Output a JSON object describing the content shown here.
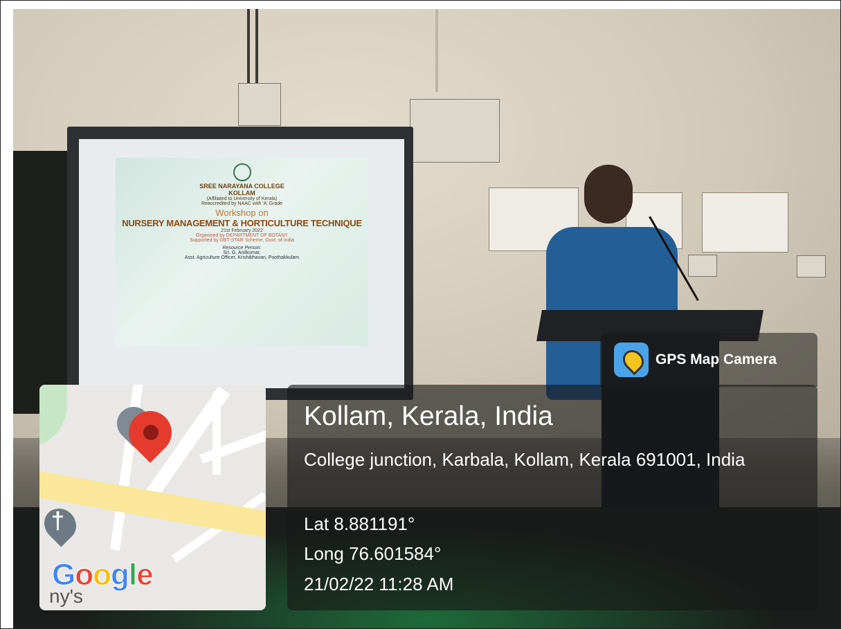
{
  "slide": {
    "line1": "SREE NARAYANA COLLEGE",
    "line1b": "KOLLAM",
    "line2": "(Affiliated to University of Kerala)",
    "line2b": "Reaccredited by NAAC with 'A' Grade",
    "line3": "Workshop on",
    "line4": "NURSERY MANAGEMENT & HORTICULTURE TECHNIQUE",
    "date": "21st February 2022",
    "organised": "Organised by DEPARTMENT OF BOTANY",
    "supported": "Supported by DBT-STAR Scheme, Govt. of India",
    "rp_label": "Resource Person:",
    "rp_name": "Sri. G. Anilkumar,",
    "rp_role": "Asst. Agriculture Officer, Krishibhavan, Poothakkulam"
  },
  "gps": {
    "app_name": "GPS Map Camera",
    "city": "Kollam, Kerala, India",
    "address": "College junction, Karbala, Kollam, Kerala 691001, India",
    "lat": "Lat 8.881191°",
    "long": "Long 76.601584°",
    "datetime": "21/02/22 11:28 AM"
  },
  "map": {
    "brand": "Google",
    "label_fragment": "ny's"
  },
  "colors": {
    "pin": "#e53b2f",
    "highway": "#fbe79a",
    "overlay": "rgba(25,25,25,0.62)"
  }
}
